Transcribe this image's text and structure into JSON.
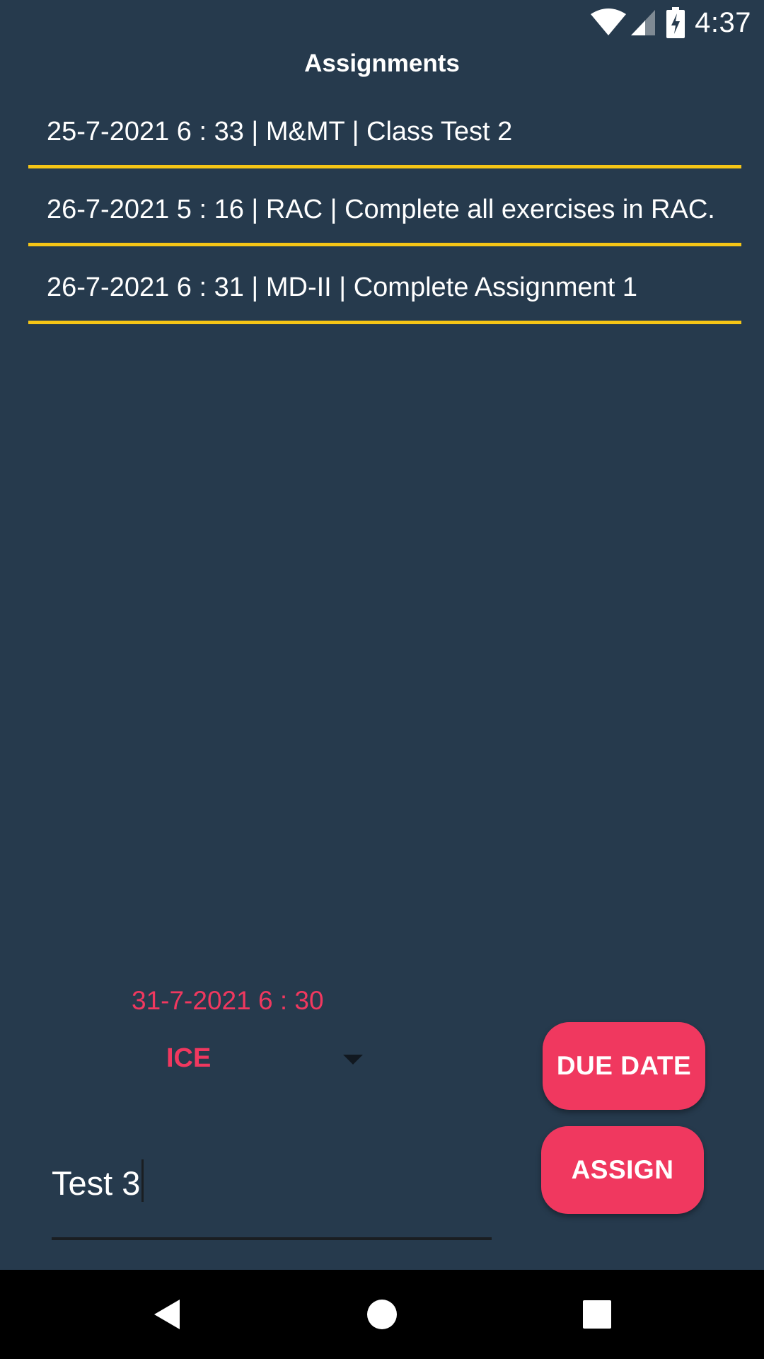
{
  "status_bar": {
    "time": "4:37",
    "icons": [
      "wifi-icon",
      "cell-signal-icon",
      "battery-charging-icon"
    ]
  },
  "page": {
    "title": "Assignments"
  },
  "assignments": [
    {
      "text": "25-7-2021 6 : 33 | M&MT | Class Test 2"
    },
    {
      "text": "26-7-2021 5 : 16 | RAC | Complete all exercises in RAC."
    },
    {
      "text": "26-7-2021 6 : 31 | MD-II | Complete Assignment 1"
    }
  ],
  "form": {
    "due_date": "31-7-2021 6 : 30",
    "subject_selected": "ICE",
    "assignment_input": "Test 3",
    "due_date_button": "DUE DATE",
    "assign_button": "ASSIGN"
  },
  "navigation": {
    "icons": [
      "back-icon",
      "home-icon",
      "recents-icon"
    ]
  },
  "colors": {
    "background": "#263a4d",
    "accent": "#f0385f",
    "divider": "#f5c516"
  }
}
